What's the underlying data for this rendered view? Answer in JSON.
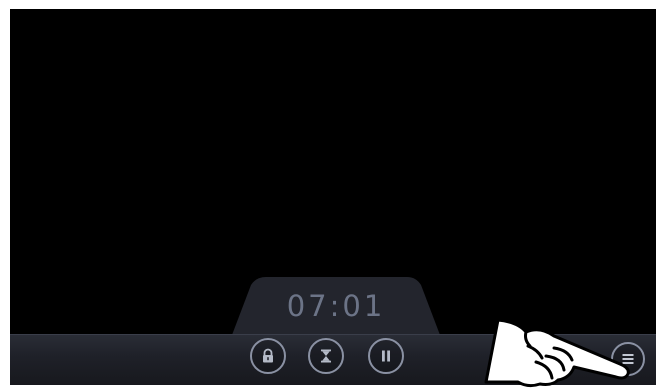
{
  "player": {
    "elapsed_time": "07:01"
  },
  "controls": {
    "lock": {
      "icon": "lock-icon"
    },
    "timer": {
      "icon": "hourglass-icon"
    },
    "pause": {
      "icon": "pause-icon"
    },
    "menu": {
      "icon": "menu-icon"
    }
  },
  "overlay": {
    "icon": "pointing-hand-icon"
  },
  "colors": {
    "background": "#000000",
    "bar": "#1f2129",
    "time_tab": "#23252d",
    "time_text": "#6c7487",
    "icon": "#8a91a3"
  }
}
